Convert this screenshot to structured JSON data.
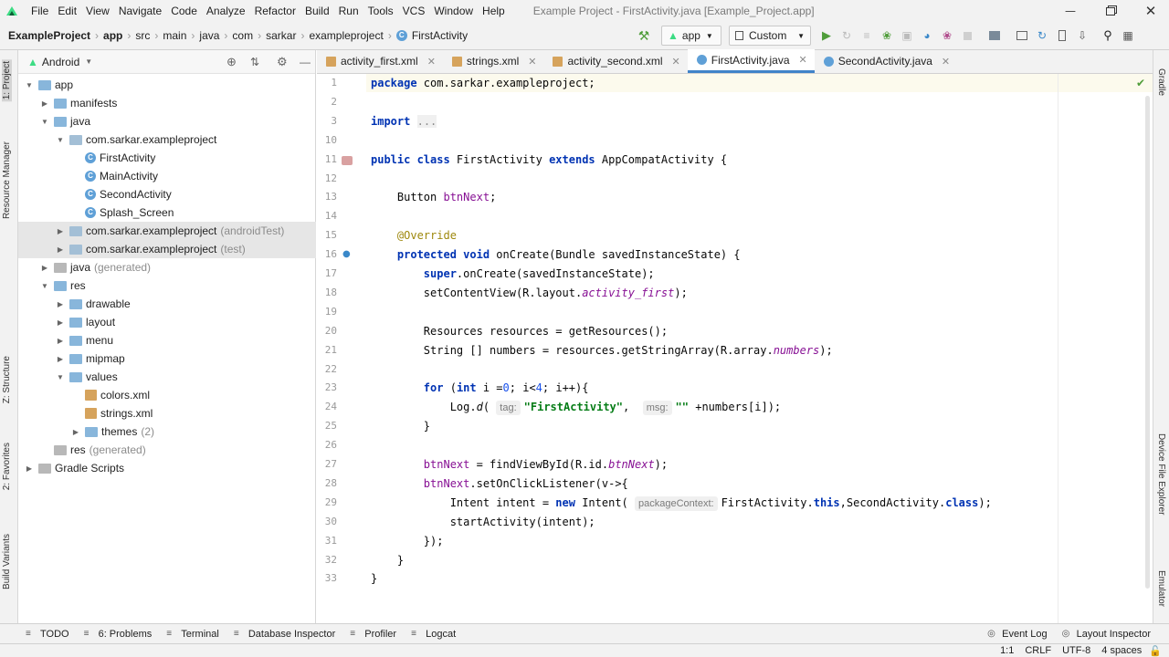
{
  "menu": [
    "File",
    "Edit",
    "View",
    "Navigate",
    "Code",
    "Analyze",
    "Refactor",
    "Build",
    "Run",
    "Tools",
    "VCS",
    "Window",
    "Help"
  ],
  "window_title": "Example Project - FirstActivity.java [Example_Project.app]",
  "breadcrumb": [
    "ExampleProject",
    "app",
    "src",
    "main",
    "java",
    "com",
    "sarkar",
    "exampleproject",
    "FirstActivity"
  ],
  "toolbar": {
    "config": "app",
    "device": "Custom"
  },
  "left_tabs": [
    "1: Project",
    "Resource Manager",
    "Z: Structure",
    "2: Favorites",
    "Build Variants"
  ],
  "right_tabs": [
    "Gradle",
    "Device File Explorer",
    "Emulator"
  ],
  "project": {
    "view": "Android",
    "tree": [
      {
        "label": "app",
        "depth": 0,
        "arrow": "▼",
        "icon": "folder",
        "suffix": ""
      },
      {
        "label": "manifests",
        "depth": 1,
        "arrow": "▶",
        "icon": "folder",
        "suffix": ""
      },
      {
        "label": "java",
        "depth": 1,
        "arrow": "▼",
        "icon": "folder",
        "suffix": ""
      },
      {
        "label": "com.sarkar.exampleproject",
        "depth": 2,
        "arrow": "▼",
        "icon": "package",
        "suffix": ""
      },
      {
        "label": "FirstActivity",
        "depth": 3,
        "arrow": "",
        "icon": "class",
        "suffix": ""
      },
      {
        "label": "MainActivity",
        "depth": 3,
        "arrow": "",
        "icon": "class",
        "suffix": ""
      },
      {
        "label": "SecondActivity",
        "depth": 3,
        "arrow": "",
        "icon": "class",
        "suffix": ""
      },
      {
        "label": "Splash_Screen",
        "depth": 3,
        "arrow": "",
        "icon": "class",
        "suffix": ""
      },
      {
        "label": "com.sarkar.exampleproject",
        "depth": 2,
        "arrow": "▶",
        "icon": "package",
        "suffix": "(androidTest)",
        "hl": true
      },
      {
        "label": "com.sarkar.exampleproject",
        "depth": 2,
        "arrow": "▶",
        "icon": "package",
        "suffix": "(test)",
        "hl": true
      },
      {
        "label": "java",
        "depth": 1,
        "arrow": "▶",
        "icon": "folder-gray",
        "suffix": "(generated)"
      },
      {
        "label": "res",
        "depth": 1,
        "arrow": "▼",
        "icon": "folder",
        "suffix": ""
      },
      {
        "label": "drawable",
        "depth": 2,
        "arrow": "▶",
        "icon": "folder",
        "suffix": ""
      },
      {
        "label": "layout",
        "depth": 2,
        "arrow": "▶",
        "icon": "folder",
        "suffix": ""
      },
      {
        "label": "menu",
        "depth": 2,
        "arrow": "▶",
        "icon": "folder",
        "suffix": ""
      },
      {
        "label": "mipmap",
        "depth": 2,
        "arrow": "▶",
        "icon": "folder",
        "suffix": ""
      },
      {
        "label": "values",
        "depth": 2,
        "arrow": "▼",
        "icon": "folder",
        "suffix": ""
      },
      {
        "label": "colors.xml",
        "depth": 3,
        "arrow": "",
        "icon": "xml",
        "suffix": ""
      },
      {
        "label": "strings.xml",
        "depth": 3,
        "arrow": "",
        "icon": "xml",
        "suffix": ""
      },
      {
        "label": "themes",
        "depth": 3,
        "arrow": "▶",
        "icon": "folder",
        "suffix": "(2)"
      },
      {
        "label": "res",
        "depth": 1,
        "arrow": "",
        "icon": "folder-gray",
        "suffix": "(generated)"
      },
      {
        "label": "Gradle Scripts",
        "depth": 0,
        "arrow": "▶",
        "icon": "gradle",
        "suffix": ""
      }
    ]
  },
  "tabs": [
    {
      "label": "activity_first.xml",
      "icon": "xml"
    },
    {
      "label": "strings.xml",
      "icon": "xml"
    },
    {
      "label": "activity_second.xml",
      "icon": "xml"
    },
    {
      "label": "FirstActivity.java",
      "icon": "class",
      "active": true
    },
    {
      "label": "SecondActivity.java",
      "icon": "class"
    }
  ],
  "code_lines": [
    {
      "n": "1",
      "html": "<span class=\"kw\">package</span> com.sarkar.exampleproject;"
    },
    {
      "n": "2",
      "html": ""
    },
    {
      "n": "3",
      "html": "<span class=\"kw\">import</span> <span style=\"color:#8c8c8c;background:#f0f0f0\">...</span>"
    },
    {
      "n": "10",
      "html": ""
    },
    {
      "n": "11",
      "html": "<span class=\"kw\">public class</span> FirstActivity <span class=\"kw\">extends</span> AppCompatActivity {"
    },
    {
      "n": "12",
      "html": ""
    },
    {
      "n": "13",
      "html": "    Button <span class=\"fld\" style=\"font-style:normal;color:#871094\">btnNext</span>;"
    },
    {
      "n": "14",
      "html": ""
    },
    {
      "n": "15",
      "html": "    <span class=\"ann\">@Override</span>"
    },
    {
      "n": "16",
      "html": "    <span class=\"kw\">protected void</span> onCreate(Bundle savedInstanceState) {"
    },
    {
      "n": "17",
      "html": "        <span class=\"kw\">super</span>.onCreate(savedInstanceState);"
    },
    {
      "n": "18",
      "html": "        setContentView(R.layout.<span class=\"fld\">activity_first</span>);"
    },
    {
      "n": "19",
      "html": ""
    },
    {
      "n": "20",
      "html": "        Resources resources = getResources();"
    },
    {
      "n": "21",
      "html": "        String [] numbers = resources.getStringArray(R.array.<span class=\"fld\">numbers</span>);"
    },
    {
      "n": "22",
      "html": ""
    },
    {
      "n": "23",
      "html": "        <span class=\"kw\">for</span> (<span class=\"kw\">int</span> i =<span style=\"color:#1750eb\">0</span>; i&lt;<span style=\"color:#1750eb\">4</span>; i++){"
    },
    {
      "n": "24",
      "html": "            Log.<span style=\"font-style:italic\">d</span>( <span class=\"hint\">tag:</span><span class=\"str\">\"FirstActivity\"</span>,  <span class=\"hint\">msg:</span><span class=\"str\">\"\"</span> +numbers[i]);"
    },
    {
      "n": "25",
      "html": "        }"
    },
    {
      "n": "26",
      "html": ""
    },
    {
      "n": "27",
      "html": "        <span style=\"color:#871094\">btnNext</span> = findViewById(R.id.<span class=\"fld\">btnNext</span>);"
    },
    {
      "n": "28",
      "html": "        <span style=\"color:#871094\">btnNext</span>.setOnClickListener(v-&gt;{"
    },
    {
      "n": "29",
      "html": "            Intent intent = <span class=\"kw\">new</span> Intent( <span class=\"hint\">packageContext:</span>FirstActivity.<span class=\"kw\">this</span>,SecondActivity.<span class=\"kw\">class</span>);"
    },
    {
      "n": "30",
      "html": "            startActivity(intent);"
    },
    {
      "n": "31",
      "html": "        });"
    },
    {
      "n": "32",
      "html": "    }"
    },
    {
      "n": "33",
      "html": "}"
    }
  ],
  "bottom_tools": [
    {
      "label": "TODO",
      "icon": "list-icon"
    },
    {
      "label": "6: Problems",
      "icon": "problems-icon"
    },
    {
      "label": "Terminal",
      "icon": "terminal-icon"
    },
    {
      "label": "Database Inspector",
      "icon": "database-icon"
    },
    {
      "label": "Profiler",
      "icon": "profiler-icon"
    },
    {
      "label": "Logcat",
      "icon": "logcat-icon"
    }
  ],
  "bottom_right": [
    {
      "label": "Event Log",
      "icon": "event-log-icon"
    },
    {
      "label": "Layout Inspector",
      "icon": "layout-inspector-icon"
    }
  ],
  "status": {
    "position": "1:1",
    "line_sep": "CRLF",
    "encoding": "UTF-8",
    "indent": "4 spaces"
  }
}
